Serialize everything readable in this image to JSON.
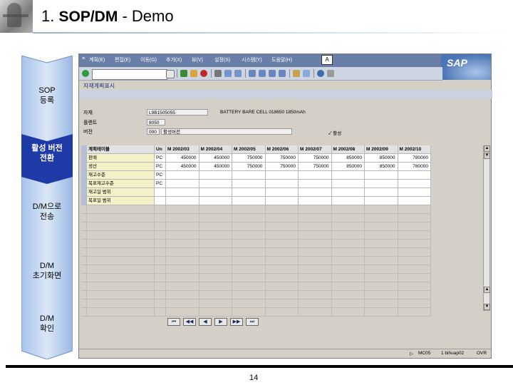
{
  "slide": {
    "title_number": "1.",
    "title_bold": "SOP/DM",
    "title_rest": "- Demo",
    "page_number": "14"
  },
  "process_steps": [
    {
      "label": "SOP\n등록",
      "active": false
    },
    {
      "label": "활성 버전\n전환",
      "active": true
    },
    {
      "label": "D/M으로\n전송",
      "active": false
    },
    {
      "label": "D/M\n초기화면",
      "active": false
    },
    {
      "label": "D/M\n확인",
      "active": false
    }
  ],
  "sap": {
    "menu_items": [
      "계획(E)",
      "편집(E)",
      "이동(G)",
      "추가(X)",
      "뷰(V)",
      "설정(S)",
      "시스템(Y)",
      "도움말(H)"
    ],
    "logo_text": "SAP",
    "screen_title": "자재계획표시",
    "fields": {
      "material_label": "자재",
      "material_value": "L9B1505055",
      "material_desc": "BATTERY BARE CELL 018650 1850mAh",
      "plant_label": "플랜트",
      "plant_value": "8050",
      "version_label": "버전",
      "version_value": "000",
      "version_desc": "활성버전",
      "active_flag": "활성"
    },
    "grid": {
      "header_first": "계획테이블",
      "header_unit": "Un",
      "months": [
        "M 2002/03",
        "M 2002/04",
        "M 2002/05",
        "M 2002/06",
        "M 2002/07",
        "M 2002/08",
        "M 2002/09",
        "M 2002/10"
      ],
      "rows": [
        {
          "label": "판매",
          "unit": "PC",
          "values": [
            "450000",
            "450000",
            "750000",
            "750000",
            "750000",
            "850000",
            "850000",
            "780000"
          ]
        },
        {
          "label": "생산",
          "unit": "PC",
          "values": [
            "450000",
            "450000",
            "750000",
            "750000",
            "750000",
            "850000",
            "850000",
            "780000"
          ]
        },
        {
          "label": "재고수준",
          "unit": "PC",
          "values": [
            "",
            "",
            "",
            "",
            "",
            "",
            "",
            ""
          ]
        },
        {
          "label": "목표재고수준",
          "unit": "PC",
          "values": [
            "",
            "",
            "",
            "",
            "",
            "",
            "",
            ""
          ]
        },
        {
          "label": "재고일 범위",
          "unit": "",
          "values": [
            "",
            "",
            "",
            "",
            "",
            "",
            "",
            ""
          ]
        },
        {
          "label": "목표일 범위",
          "unit": "",
          "values": [
            "",
            "",
            "",
            "",
            "",
            "",
            "",
            ""
          ]
        }
      ]
    },
    "nav_buttons": [
      "⏮",
      "◀◀",
      "◀",
      "▶",
      "▶▶",
      "⏭"
    ],
    "status": {
      "system": "MC05",
      "client": "1 bihuap02",
      "mode": "OVR"
    }
  }
}
